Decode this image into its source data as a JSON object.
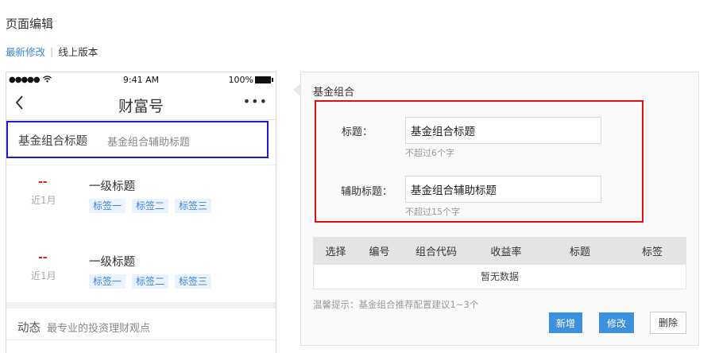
{
  "page": {
    "title": "页面编辑"
  },
  "version_tabs": {
    "latest": "最新修改",
    "online": "线上版本"
  },
  "phone": {
    "status_bar": {
      "signal": "●●●●●",
      "wifi_icon": "wifi-icon",
      "time": "9:41 AM",
      "battery": "100%"
    },
    "nav": {
      "back_icon": "chevron-left-icon",
      "title": "财富号",
      "more_icon": "more-icon",
      "more": "•••"
    },
    "fund_header": {
      "title": "基金组合标题",
      "subtitle": "基金组合辅助标题"
    },
    "items": [
      {
        "rate": "--",
        "period": "近1月",
        "title": "一级标题",
        "tags": [
          "标签一",
          "标签二",
          "标签三"
        ]
      },
      {
        "rate": "--",
        "period": "近1月",
        "title": "一级标题",
        "tags": [
          "标签一",
          "标签二",
          "标签三"
        ]
      }
    ],
    "dynamic": {
      "title": "动态",
      "subtitle": "最专业的投资理财观点"
    }
  },
  "editor": {
    "heading": "基金组合",
    "title_field": {
      "label": "标题：",
      "value": "基金组合标题",
      "hint": "不超过6个字"
    },
    "subtitle_field": {
      "label": "辅助标题：",
      "value": "基金组合辅助标题",
      "hint": "不超过15个字"
    },
    "table": {
      "columns": [
        "选择",
        "编号",
        "组合代码",
        "收益率",
        "标题",
        "标签"
      ],
      "empty_text": "暂无数据"
    },
    "tip": "温馨提示：基金组合推荐配置建议1~3个",
    "buttons": {
      "add": "新增",
      "edit": "修改",
      "delete": "删除"
    }
  },
  "colors": {
    "accent": "#3b87d8",
    "highlight_red": "#e01010",
    "highlight_blue": "#1a1ad8",
    "rate_red": "#e02020"
  }
}
